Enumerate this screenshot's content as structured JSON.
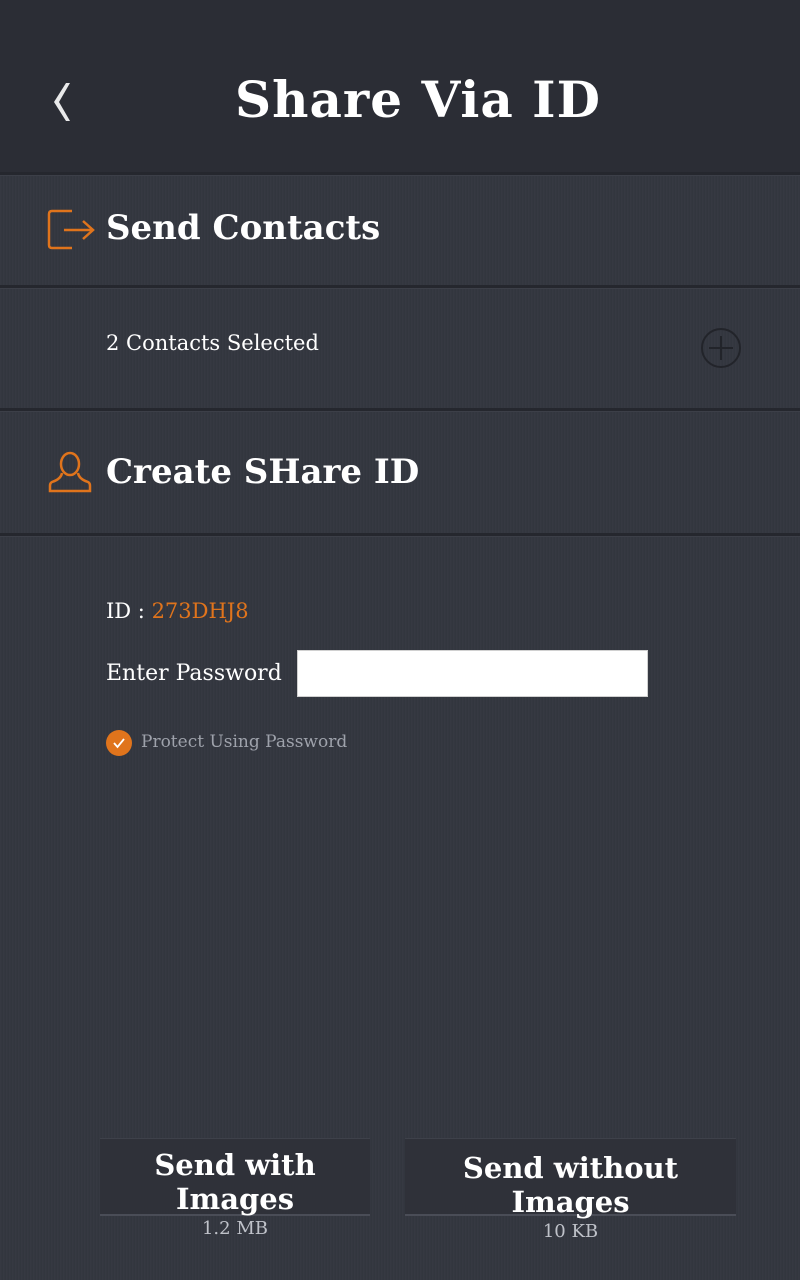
{
  "header": {
    "title": "Share Via ID",
    "back_icon": "chevron-left-icon"
  },
  "send_contacts": {
    "label": "Send Contacts",
    "icon": "exit-arrow-icon",
    "selected_text": "2 Contacts Selected",
    "add_icon": "plus-circle-icon"
  },
  "create_share_id": {
    "label": "Create SHare ID",
    "icon": "user-icon",
    "id_prefix": "ID : ",
    "id_value": "273DHJ8",
    "password_label": "Enter Password",
    "password_value": "",
    "protect_label": "Protect Using Password",
    "protect_checked": true
  },
  "actions": {
    "with_images_label": "Send with Images",
    "with_images_size": "1.2 MB",
    "without_images_label": "Send without Images",
    "without_images_size": "10 KB"
  },
  "colors": {
    "accent": "#e0741c",
    "background": "#33363f",
    "header": "#2b2d35"
  }
}
